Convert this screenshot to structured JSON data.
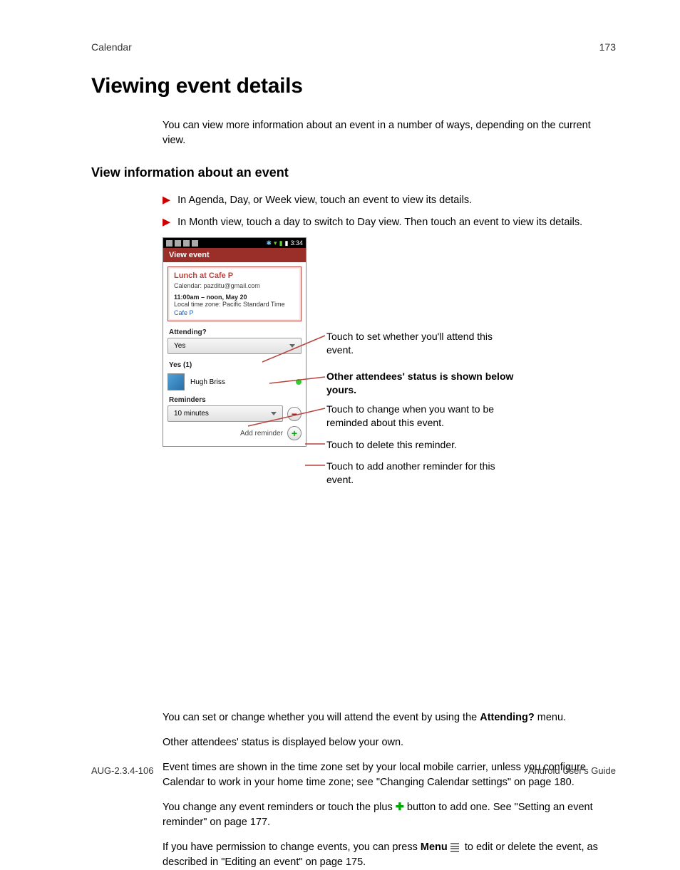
{
  "header": {
    "section": "Calendar",
    "pageno": "173"
  },
  "title": "Viewing event details",
  "intro": "You can view more information about an event in a number of ways, depending on the current view.",
  "subhead": "View information about an event",
  "bullets": [
    "In Agenda, Day, or Week view, touch an event to view its details.",
    "In Month view, touch a day to switch to Day view. Then touch an event to view its details."
  ],
  "phone": {
    "time": "3:34",
    "titlebar": "View event",
    "event": {
      "title": "Lunch at Cafe P",
      "calendar_lbl": "Calendar:  pazditu@gmail.com",
      "timeline": "11:00am – noon, May 20",
      "tz": "Local time zone:  Pacific Standard Time",
      "loc": "Cafe P"
    },
    "attending_lbl": "Attending?",
    "attending_val": "Yes",
    "yes_count": "Yes (1)",
    "attendee": "Hugh Briss",
    "reminders_lbl": "Reminders",
    "reminder_val": "10 minutes",
    "addrem": "Add reminder"
  },
  "callouts": {
    "c1": "Touch to set whether you'll attend this event.",
    "c2": "Other attendees' status is shown below yours.",
    "c3": "Touch to change when you want to be reminded about this event.",
    "c4": "Touch to delete this reminder.",
    "c5": "Touch to add another reminder for this event."
  },
  "body": {
    "p1a": "You can set or change whether you will attend the event by using the ",
    "p1b": "Attending?",
    "p1c": " menu.",
    "p2": "Other attendees' status is displayed below your own.",
    "p3": "Event times are shown in the time zone set by your local mobile carrier, unless you configure Calendar to work in your home time zone; see \"Changing Calendar settings\" on page 180.",
    "p4a": "You change any event reminders or touch the plus ",
    "p4b": " button to add one. See \"Setting an event reminder\" on page 177.",
    "p5a": "If you have permission to change events, you can press ",
    "p5b": "Menu",
    "p5c": " to edit or delete the event, as described in \"Editing an event\" on page 175."
  },
  "footer": {
    "left": "AUG-2.3.4-106",
    "right": "Android User's Guide"
  }
}
